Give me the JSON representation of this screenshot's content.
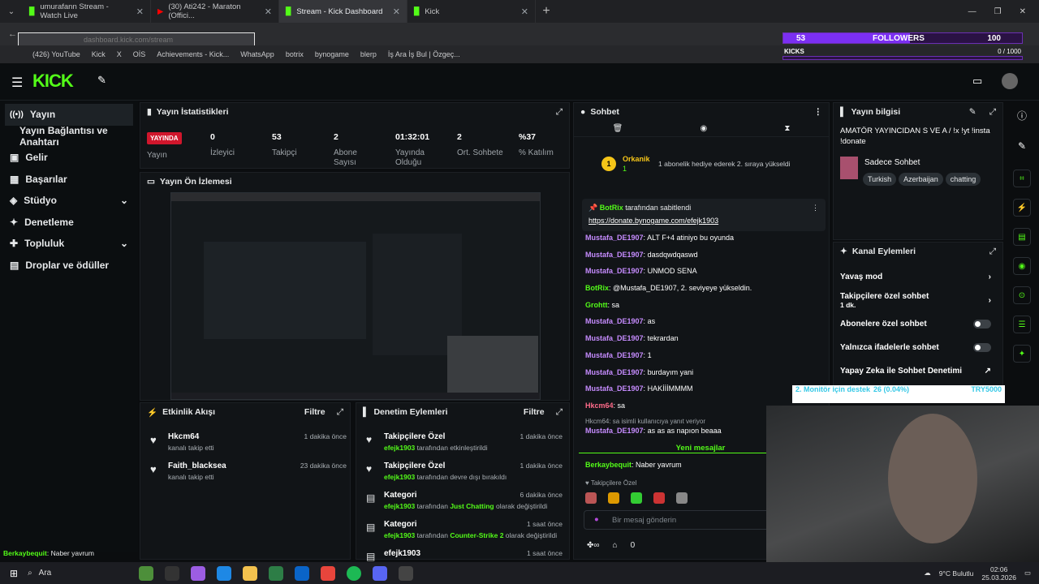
{
  "browser": {
    "tabs": [
      {
        "label": "umurafann Stream - Watch Live",
        "active": false
      },
      {
        "label": "(30) Ati242 - Maraton (Offici...",
        "active": false
      },
      {
        "label": "Stream - Kick Dashboard",
        "active": true
      },
      {
        "label": "Kick",
        "active": false
      }
    ],
    "url": "dashboard.kick.com/stream",
    "bookmarks": [
      "(426) YouTube",
      "Kick",
      "X",
      "OİS",
      "Achievements - Kick...",
      "WhatsApp",
      "botrix",
      "bynogame",
      "blerp",
      "İş Ara İş Bul | Özgeç..."
    ]
  },
  "overlay": {
    "followers_count": "53",
    "followers_label": "FOLLOWERS",
    "goal": "100",
    "kicks_label": "KICKS",
    "kicks_progress": "0 / 1000"
  },
  "sidebar": {
    "items": [
      "Yayın",
      "Yayın Bağlantısı ve Anahtarı",
      "Gelir",
      "Başarılar",
      "Stüdyo",
      "Denetleme",
      "Topluluk",
      "Droplar ve ödüller"
    ]
  },
  "stats": {
    "title": "Yayın İstatistikleri",
    "live_badge": "YAYINDA",
    "live_label": "Yayın",
    "items": [
      {
        "value": "0",
        "label": "İzleyici"
      },
      {
        "value": "53",
        "label": "Takipçi"
      },
      {
        "value": "2",
        "label": "Abone Sayısı"
      },
      {
        "value": "01:32:01",
        "label": "Yayında Olduğu"
      },
      {
        "value": "2",
        "label": "Ort. Sohbete"
      },
      {
        "value": "%37",
        "label": "% Katılım"
      }
    ]
  },
  "preview": {
    "title": "Yayın Ön İzlemesi"
  },
  "activity": {
    "title": "Etkinlik Akışı",
    "filter": "Filtre",
    "items": [
      {
        "name": "Hkcm64",
        "sub": "kanalı takip etti",
        "time": "1 dakika önce"
      },
      {
        "name": "Faith_blacksea",
        "sub": "kanalı takip etti",
        "time": "23 dakika önce"
      }
    ]
  },
  "moderation": {
    "title": "Denetim Eylemleri",
    "filter": "Filtre",
    "items": [
      {
        "title": "Takipçilere Özel",
        "user": "efejk1903",
        "pre": " tarafından ",
        "hl": "",
        "post": "etkinleştirildi",
        "time": "1 dakika önce"
      },
      {
        "title": "Takipçilere Özel",
        "user": "efejk1903",
        "pre": " tarafından ",
        "hl": "",
        "post": "devre dışı bırakıldı",
        "time": "1 dakika önce"
      },
      {
        "title": "Kategori",
        "user": "efejk1903",
        "pre": " tarafından ",
        "hl": "Just Chatting",
        "post": " olarak değiştirildi",
        "time": "6 dakika önce"
      },
      {
        "title": "Kategori",
        "user": "efejk1903",
        "pre": " tarafından ",
        "hl": "Counter-Strike 2",
        "post": " olarak değiştirildi",
        "time": "1 saat önce"
      },
      {
        "title": "efejk1903",
        "user": "",
        "pre": "",
        "hl": "",
        "post": "",
        "time": "1 saat önce"
      }
    ]
  },
  "chat": {
    "title": "Sohbet",
    "gift": {
      "rank": "1",
      "user": "Orkanik",
      "count": "1",
      "text": "1 abonelik hediye ederek 2. sıraya yükseldi"
    },
    "pinned": {
      "by": "BotRix",
      "suffix": "tarafından sabitlendi",
      "link": "https://donate.bynogame.com/efejk1903"
    },
    "messages": [
      {
        "user": "Mustafa_DE1907",
        "text": "ALT F+4 atiniyo bu oyunda"
      },
      {
        "user": "Mustafa_DE1907",
        "text": "dasdqwdqaswd"
      },
      {
        "user": "Mustafa_DE1907",
        "text": "UNMOD SENA"
      },
      {
        "user": "BotRix",
        "text": "@Mustafa_DE1907, 2. seviyeye yükseldin."
      },
      {
        "user": "Grohtt",
        "text": "sa"
      },
      {
        "user": "Mustafa_DE1907",
        "text": "as"
      },
      {
        "user": "Mustafa_DE1907",
        "text": "tekrardan"
      },
      {
        "user": "Mustafa_DE1907",
        "text": "1"
      },
      {
        "user": "Mustafa_DE1907",
        "text": "burdayım yani"
      },
      {
        "user": "Mustafa_DE1907",
        "text": "HAKİİİMMMM"
      },
      {
        "user": "Hkcm64",
        "text": "sa"
      }
    ],
    "reply_note": "Hkcm64: sa isimli kullanıcıya yanıt veriyor",
    "reply": {
      "user": "Mustafa_DE1907",
      "text": "as as as napıon beaaa"
    },
    "new_messages": "Yeni mesajlar",
    "last": {
      "user": "Berkaybequit",
      "text": "Naber yavrum"
    },
    "followers_only": "Takipçilere Özel",
    "placeholder": "Bir mesaj gönderin",
    "count": "0"
  },
  "info": {
    "title": "Yayın bilgisi",
    "stream_title": "AMATÖR YAYINCIDAN S VE A / !x !yt !insta !donate",
    "category": "Sadece Sohbet",
    "tags": [
      "Turkish",
      "Azerbaijan",
      "chatting"
    ]
  },
  "channel": {
    "title": "Kanal Eylemleri",
    "slow": "Yavaş mod",
    "followers": "Takipçilere özel sohbet",
    "followers_sub": "1 dk.",
    "subs": "Abonelere özel sohbet",
    "emotes": "Yalnızca ifadelerle sohbet",
    "ai": "Yapay Zeka ile Sohbet Denetimi"
  },
  "overlay2": {
    "monitor": "2. Monitör için destek",
    "donation": "26 (0.04%)",
    "code": "TRY5000"
  },
  "bottom_status": {
    "user": "Berkaybequit",
    "text": "Naber yavrum"
  },
  "taskbar": {
    "search": "Ara",
    "weather": "9°C Bulutlu",
    "time": "02:06",
    "date": "25.03.2026"
  },
  "colors": {
    "accent": "#53fc18",
    "live": "#d1162c",
    "username": "#c68cff"
  }
}
